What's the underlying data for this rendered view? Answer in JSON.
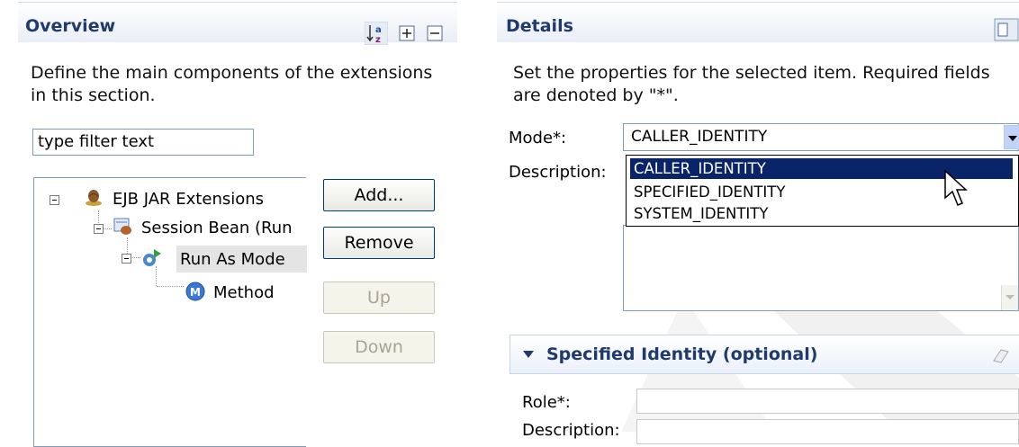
{
  "overview": {
    "title": "Overview",
    "description_line1": "Define the main components of the extensions",
    "description_line2": "in this section.",
    "filter_placeholder": "type filter text",
    "toolbar_icons": [
      "sort-alpha-icon",
      "expand-all-icon",
      "collapse-all-icon"
    ],
    "tree": [
      {
        "label": "EJB JAR Extensions",
        "icon": "bean-icon",
        "level": 0
      },
      {
        "label": "Session Bean (Run",
        "icon": "session-bean-icon",
        "level": 1
      },
      {
        "label": "Run As Mode",
        "icon": "run-as-mode-icon",
        "level": 2,
        "selected": true
      },
      {
        "label": "Method",
        "icon": "method-icon",
        "level": 3
      }
    ],
    "buttons": {
      "add": "Add...",
      "remove": "Remove",
      "up": "Up",
      "down": "Down"
    }
  },
  "details": {
    "title": "Details",
    "description_line1": "Set the properties for the selected item. Required fields",
    "description_line2": "are denoted by \"*\".",
    "mode_label": "Mode*:",
    "mode_value": "CALLER_IDENTITY",
    "description_label": "Description:",
    "mode_options": [
      "CALLER_IDENTITY",
      "SPECIFIED_IDENTITY",
      "SYSTEM_IDENTITY"
    ],
    "specified_identity": {
      "title": "Specified Identity (optional)",
      "role_label": "Role*:",
      "description_label": "Description:"
    }
  },
  "colors": {
    "header_text": "#1f3a6b",
    "selection": "#0a246a",
    "tree_selection": "#e0e0e0",
    "border": "#7f9db9"
  }
}
